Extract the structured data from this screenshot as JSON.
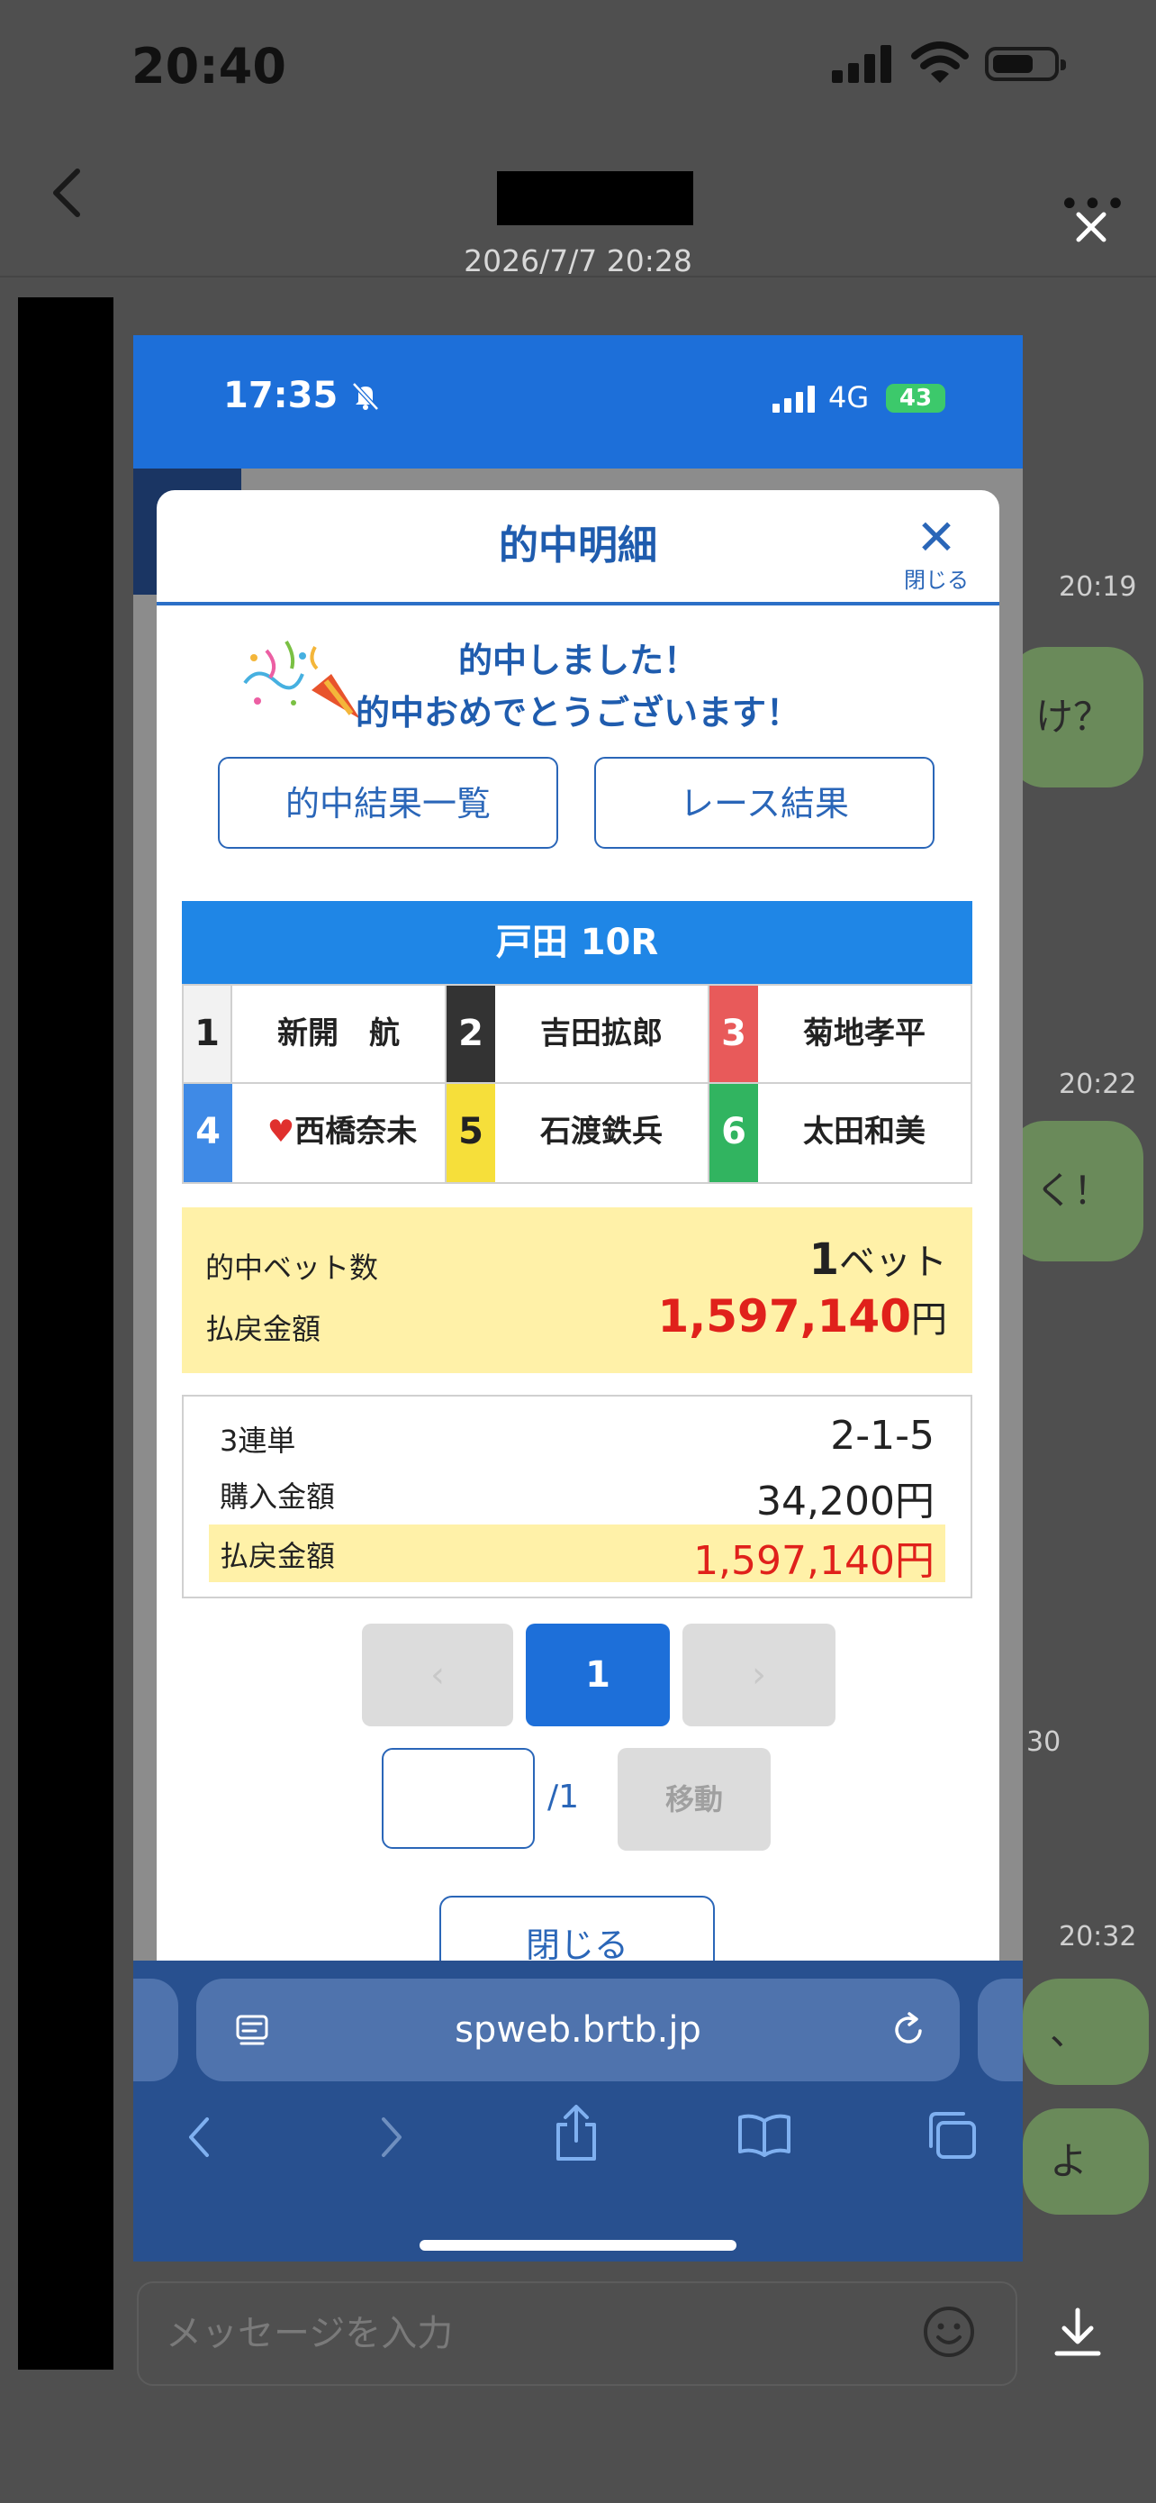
{
  "outer": {
    "status_time": "20:40",
    "timestamp": "2026/7/7 20:28",
    "chat_times": [
      "20:19",
      "20:22",
      "30",
      "20:32"
    ],
    "bubbles": [
      "け？",
      "く！",
      "、笑",
      "よ"
    ],
    "message_placeholder": "メッセージを入力"
  },
  "inner": {
    "status_time": "17:35",
    "network": "4G",
    "battery": "43"
  },
  "modal": {
    "title": "的中明細",
    "close_label": "閉じる",
    "congrats_line1": "的中しました！",
    "congrats_line2": "的中おめでとうございます！",
    "btn_results_list": "的中結果一覧",
    "btn_race_results": "レース結果",
    "race_header": "戸田 10R",
    "racers": [
      {
        "num": "1",
        "name": "新開　航",
        "color": "#f2f2f2",
        "text": "#222222"
      },
      {
        "num": "2",
        "name": "吉田拡郎",
        "color": "#333333",
        "text": "#ffffff"
      },
      {
        "num": "3",
        "name": "菊地孝平",
        "color": "#e85a5a",
        "text": "#ffffff"
      },
      {
        "num": "4",
        "name": "西橋奈未",
        "color": "#3f8ae6",
        "text": "#ffffff"
      },
      {
        "num": "5",
        "name": "石渡鉄兵",
        "color": "#f6df3a",
        "text": "#222222"
      },
      {
        "num": "6",
        "name": "太田和美",
        "color": "#31b460",
        "text": "#ffffff"
      }
    ],
    "summary": {
      "hits_label": "的中ベット数",
      "hits_num": "1",
      "hits_unit": "ベット",
      "payout_label": "払戻金額",
      "payout_value": "1,597,140",
      "payout_unit": "円"
    },
    "detail": {
      "bet_type_label": "3連単",
      "bet_type_value": "2-1-5",
      "purchase_label": "購入金額",
      "purchase_value": "34,200円",
      "payout_label": "払戻金額",
      "payout_value": "1,597,140円"
    },
    "pager": {
      "prev": "‹",
      "current": "1",
      "next": "›",
      "total": "/1",
      "goto": "移動"
    },
    "close_button": "閉じる"
  },
  "safari": {
    "url": "spweb.brtb.jp"
  }
}
